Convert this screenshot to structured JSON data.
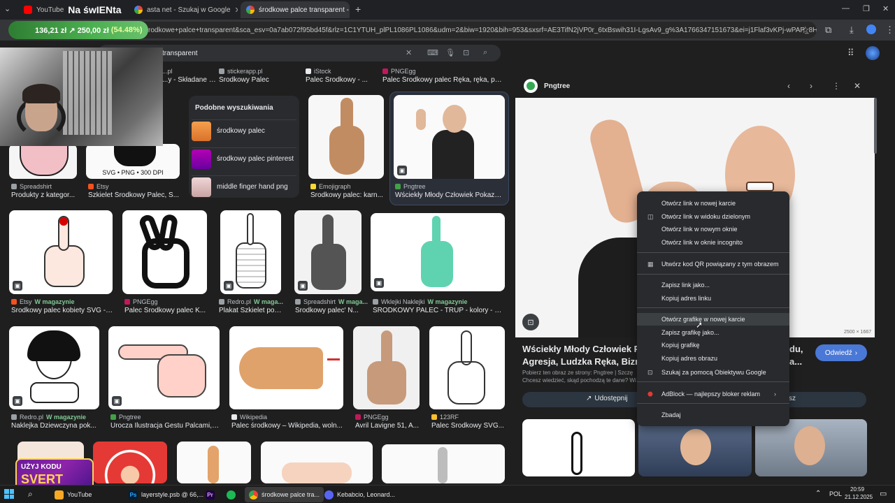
{
  "tabs": [
    {
      "label": "YouTube",
      "extra": "Na śwIENta"
    },
    {
      "label": "asta net - Szukaj w Google"
    },
    {
      "label": "środkowe palce transparent - Sz..."
    }
  ],
  "new_tab": "+",
  "url": "środkowe+palce+transparent&sca_esv=0a7ab072f95bd45f&rlz=1C1YTUH_plPL1086PL1086&udm=2&biw=1920&bih=953&sxsrf=AE3TifN2jVP0r_6txBswih31I-LgsAv9_g%3A1766347151673&ei=j1Flaf3vKPj-wPAP_8HJiQs&ved...",
  "price": {
    "text": "136,21 zł ↗ 250,00 zł",
    "pct": "(54.48%)"
  },
  "search": {
    "query": "transparent"
  },
  "grid": {
    "top_row": [
      {
        "src": "stickerapp.pl",
        "title": "Środkowy Palec"
      },
      {
        "src": "iStock",
        "title": "Palec Środkowy - ..."
      },
      {
        "src": "PNGEgg",
        "title": "Palec Środkowy palec Ręka, ręka, po..."
      },
      {
        "src": "...pl",
        "title": "...y - Składane p..."
      }
    ],
    "row1": [
      {
        "src": "Spreadshirt",
        "title": "Produkty z kategor..."
      },
      {
        "src": "Etsy",
        "title": "Szkielet Środkowy Palec, S..."
      },
      {
        "src": "Emojigraph",
        "title": "Środkowy palec: karn..."
      },
      {
        "src": "Pngtree",
        "title": "Wściekły Młody Człowiek Pokazuj..."
      }
    ],
    "row1_thumb_text": "SVG • PNG • 300 DPI",
    "row2": [
      {
        "src": "Etsy",
        "mag": "W magazynie",
        "title": "Środkowy palec kobiety SVG - ..."
      },
      {
        "src": "PNGEgg",
        "mag": "",
        "title": "Palec Środkowy palec K..."
      },
      {
        "src": "Redro.pl",
        "mag": "W maga...",
        "title": "Plakat Szkielet pok..."
      },
      {
        "src": "Spreadshirt",
        "mag": "W maga...",
        "title": "Środkowy palec' N..."
      },
      {
        "src": "Wklejki Naklejki",
        "mag": "W magazynie",
        "title": "ŚRODKOWY PALEC - TRUP - kolory - p..."
      }
    ],
    "row3": [
      {
        "src": "Redro.pl",
        "mag": "W magazynie",
        "title": "Naklejka Dziewczyna pok..."
      },
      {
        "src": "Pngtree",
        "mag": "",
        "title": "Urocza Ilustracja Gestu Palcami, ..."
      },
      {
        "src": "Wikipedia",
        "mag": "",
        "title": "Palec środkowy – Wikipedia, woln..."
      },
      {
        "src": "PNGEgg",
        "mag": "",
        "title": "Avril Lavigne 51, A..."
      },
      {
        "src": "123RF",
        "mag": "",
        "title": "Palec Środkowy SVG..."
      }
    ]
  },
  "similar": {
    "heading": "Podobne wyszukiwania",
    "items": [
      "środkowy palec",
      "środkowy palec pinterest",
      "middle finger hand png"
    ]
  },
  "panel": {
    "source": "Pngtree",
    "dims": "2500 × 1667",
    "title_line1": "Wściekły Młody Człowiek Pok",
    "title_line2": "Agresja, Ludzka Ręka, Biznes C",
    "title_tail1": "du,",
    "title_tail2": "a...",
    "sub1": "Pobierz ten obraz ze strony: Pngtree | Szczę",
    "sub2": "Chcesz wiedzieć, skąd pochodzą te dane? Wi",
    "visit": "Odwiedź",
    "share": "Udostępnij",
    "save_tail": "sz"
  },
  "context_menu": [
    "Otwórz link w nowej karcie",
    "Otwórz link w widoku dzielonym",
    "Otwórz link w nowym oknie",
    "Otwórz link w oknie incognito",
    "Utwórz kod QR powiązany z tym obrazem",
    "Zapisz link jako...",
    "Kopiuj adres linku",
    "Otwórz grafikę w nowej karcie",
    "Zapisz grafikę jako...",
    "Kopiuj grafikę",
    "Kopiuj adres obrazu",
    "Szukaj za pomocą Obiektywu Google",
    "AdBlock — najlepszy bloker reklam",
    "Zbadaj"
  ],
  "promo": {
    "line1": "UŻYJ KODU",
    "line2": "SVERT"
  },
  "taskbar": {
    "items": [
      "YouTube",
      "layerstyle.psb @ 66,...",
      "środkowe palce tra...",
      "Kebabcio, Leonard..."
    ],
    "lang": "POL",
    "time": "20:59",
    "date": "21.12.2025"
  }
}
